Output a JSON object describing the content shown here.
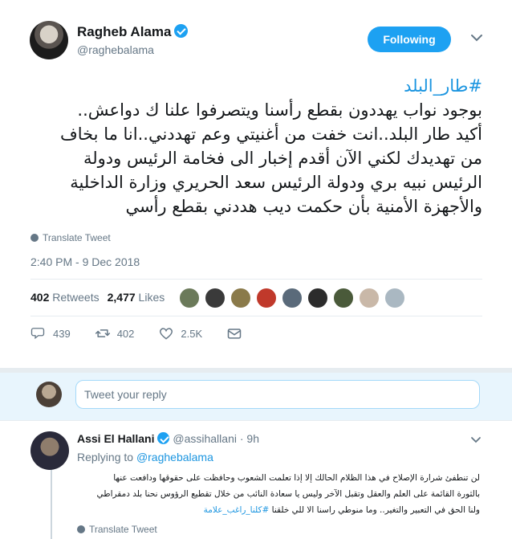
{
  "tweet": {
    "author_name": "Ragheb Alama",
    "handle": "@raghebalama",
    "follow_label": "Following",
    "hashtag": "#طار_البلد",
    "lines": [
      "بوجود نواب يهددون بقطع رأسنا ويتصرفوا علنا ك دواعش..",
      "أكيد طار البلد..انت خفت من أغنيتي وعم تهددني..انا ما بخاف",
      "من تهديدك لكني الآن أقدم إخبار الى فخامة الرئيس ودولة",
      "الرئيس نبيه بري ودولة الرئيس سعد الحريري وزارة الداخلية",
      "والأجهزة الأمنية بأن حكمت ديب هددني بقطع رأسي"
    ],
    "translate_label": "Translate Tweet",
    "timestamp": "2:40 PM - 9 Dec 2018",
    "retweets_count": "402",
    "retweets_label": "Retweets",
    "likes_count": "2,477",
    "likes_label": "Likes",
    "actions": {
      "reply_count": "439",
      "retweet_count": "402",
      "like_count": "2.5K"
    }
  },
  "likers": [
    "#6b7a5a",
    "#3a3a3a",
    "#8a7a4a",
    "#c0392b",
    "#5a6a7a",
    "#2c2c2c",
    "#4a5a3a",
    "#c9b8a8",
    "#aab8c2"
  ],
  "reply_box": {
    "placeholder": "Tweet your reply"
  },
  "reply": {
    "author_name": "Assi El Hallani",
    "handle": "@assihallani",
    "time": "· 9h",
    "replying_prefix": "Replying to",
    "replying_to": "@raghebalama",
    "lines": [
      "لن تنطفئ شرارة الإصلاح في هذا الظلام الحالك إلا إذا تعلمت  الشعوب وحافظت على حقوقها ودافعت عنها",
      "بالثورة القائمة على العلم والعقل وتقبل الآخر وليس يا سعادة النائب من خلال تقطيع الرؤوس نحنا بلد دمقراطي",
      "ولنا الحق في التعبير  والتغير.. وما منوطي راسنا الا للي خلقنا"
    ],
    "hashtag": "#كلنا_راغب_علامة",
    "translate_label": "Translate Tweet"
  }
}
